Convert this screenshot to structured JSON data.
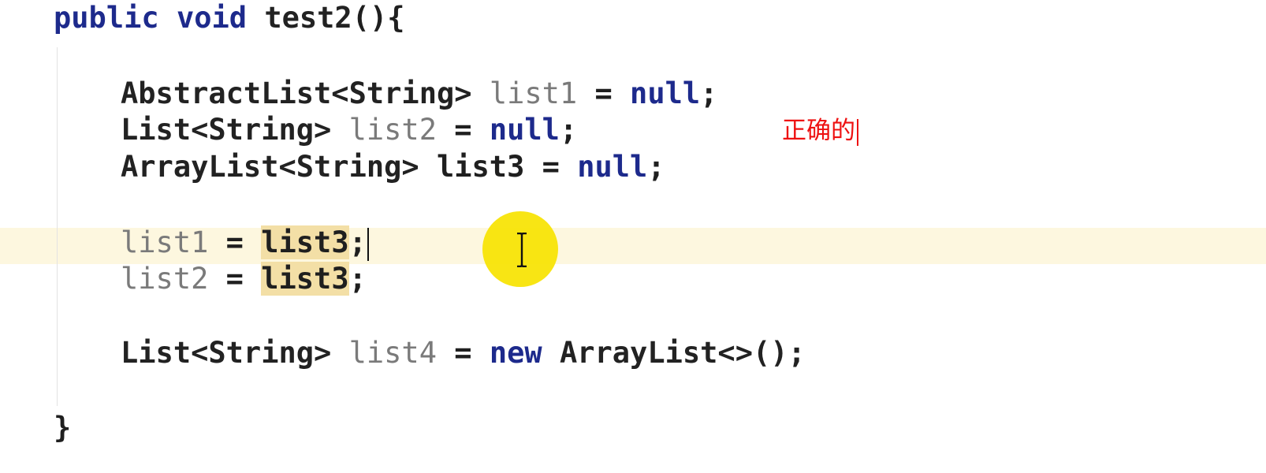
{
  "code": {
    "line1": {
      "kw1": "public",
      "kw2": "void",
      "name": "test2",
      "rest": "(){"
    },
    "line2": {
      "type": "AbstractList<String>",
      "var": "list1",
      "eq": "=",
      "val": "null",
      "semi": ";"
    },
    "line3": {
      "type": "List<String>",
      "var": "list2",
      "eq": "=",
      "val": "null",
      "semi": ";"
    },
    "line4": {
      "type": "ArrayList<String>",
      "var": "list3",
      "eq": "=",
      "val": "null",
      "semi": ";"
    },
    "line5": {
      "var": "list1",
      "eq": "=",
      "val": "list3",
      "semi": ";"
    },
    "line6": {
      "var": "list2",
      "eq": "=",
      "val": "list3",
      "semi": ";"
    },
    "line7": {
      "type": "List<String>",
      "var": "list4",
      "eq": "=",
      "kw": "new",
      "ctor": "ArrayList<>();"
    },
    "line8": {
      "brace": "}"
    }
  },
  "annotation": {
    "text": "正确的",
    "color": "#ee1111"
  },
  "colors": {
    "keyword": "#1d2a8c",
    "unused_identifier": "#7a7a7a",
    "current_line": "#fdf7df",
    "usage_highlight": "#f3dfa6",
    "cursor_halo": "#f7e300"
  },
  "icons": {
    "mouse_cursor": "ibeam-cursor-icon"
  }
}
